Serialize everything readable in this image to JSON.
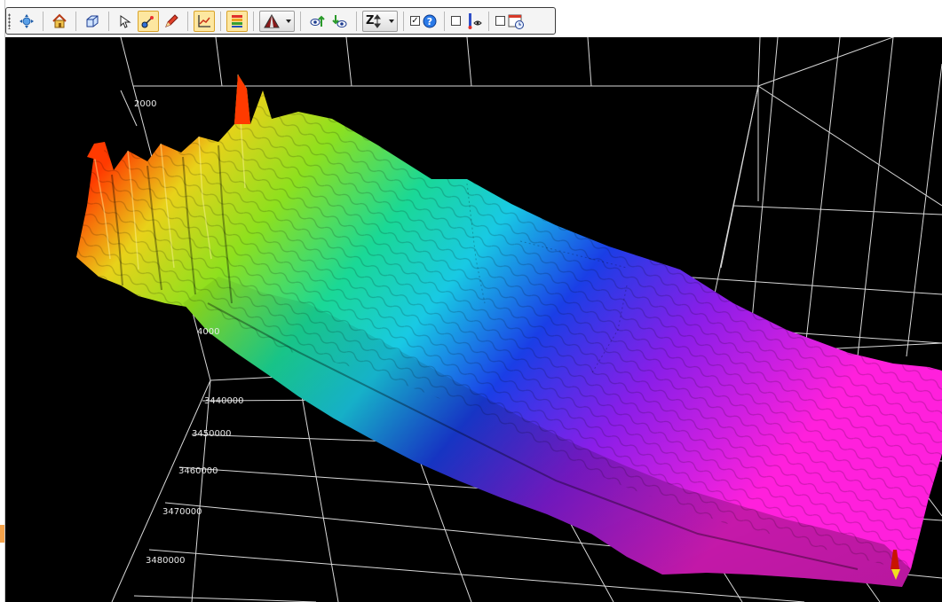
{
  "toolbar": {
    "buttons": [
      {
        "icon": "pan-move-icon",
        "active": false
      },
      {
        "icon": "home-view-icon",
        "active": false
      },
      {
        "icon": "bounding-box-icon",
        "active": false
      },
      {
        "icon": "select-pointer-icon",
        "active": false
      },
      {
        "icon": "pick-point-icon",
        "active": true
      },
      {
        "icon": "draw-pen-icon",
        "active": false
      },
      {
        "icon": "axis-chart-icon",
        "active": true
      },
      {
        "icon": "color-layers-icon",
        "active": true
      },
      {
        "icon": "render-style-dropdown-icon",
        "active": false
      },
      {
        "icon": "view-up-icon",
        "active": false
      },
      {
        "icon": "view-down-icon",
        "active": false
      },
      {
        "icon": "z-scale-dropdown-icon",
        "active": false,
        "text": "Z"
      },
      {
        "icon": "help-info-icon",
        "checked": true
      },
      {
        "icon": "well-visibility-icon",
        "checked": false
      },
      {
        "icon": "calendar-time-icon",
        "checked": false
      }
    ]
  },
  "axes": {
    "depth_ticks": [
      "2000",
      "4000"
    ],
    "northing_ticks": [
      "3440000",
      "3450000",
      "3460000",
      "3470000",
      "3480000"
    ]
  },
  "colors": {
    "background": "#000000",
    "grid": "#d8d8d8",
    "surface_high": "#ff2a00",
    "surface_mid_high": "#d6e21a",
    "surface_mid": "#18d6c4",
    "surface_mid_low": "#1a35e0",
    "surface_low": "#ff1ee0",
    "active_button": "#fde7a0"
  }
}
